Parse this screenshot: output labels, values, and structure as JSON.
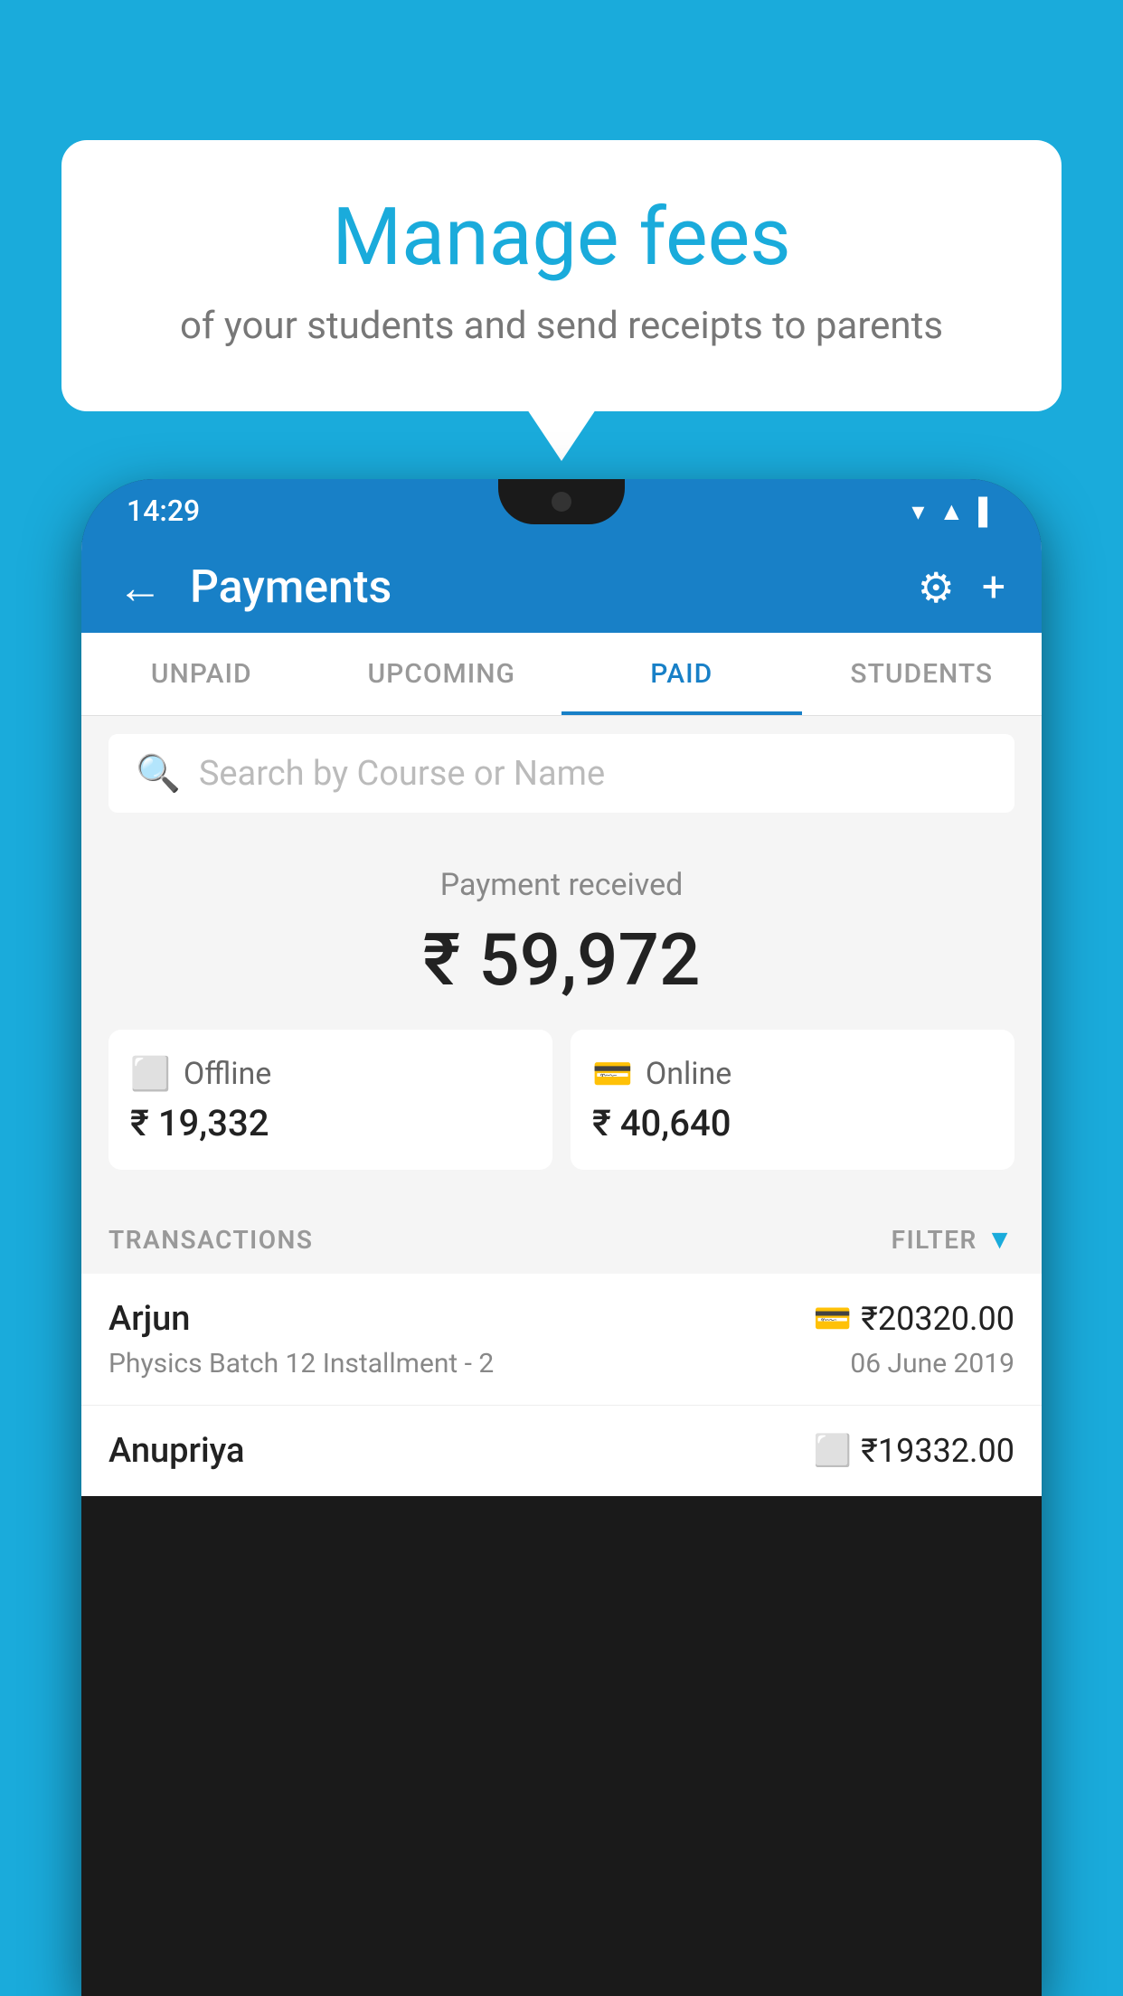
{
  "background_color": "#1AABDB",
  "bubble": {
    "title": "Manage fees",
    "subtitle": "of your students and send receipts to parents"
  },
  "phone": {
    "status_bar": {
      "time": "14:29",
      "icons": [
        "▾▾",
        "▲▲",
        "▌"
      ]
    },
    "header": {
      "title": "Payments",
      "back_icon": "←",
      "settings_icon": "⚙",
      "add_icon": "+"
    },
    "tabs": [
      {
        "label": "UNPAID",
        "active": false
      },
      {
        "label": "UPCOMING",
        "active": false
      },
      {
        "label": "PAID",
        "active": true
      },
      {
        "label": "STUDENTS",
        "active": false
      }
    ],
    "search": {
      "placeholder": "Search by Course or Name"
    },
    "payment_summary": {
      "label": "Payment received",
      "total": "₹ 59,972",
      "offline_label": "Offline",
      "offline_amount": "₹ 19,332",
      "online_label": "Online",
      "online_amount": "₹ 40,640"
    },
    "transactions_section": {
      "label": "TRANSACTIONS",
      "filter_label": "FILTER"
    },
    "transactions": [
      {
        "name": "Arjun",
        "course": "Physics Batch 12 Installment - 2",
        "amount": "₹20320.00",
        "date": "06 June 2019",
        "payment_type": "online"
      },
      {
        "name": "Anupriya",
        "amount": "₹19332.00",
        "payment_type": "offline"
      }
    ]
  }
}
